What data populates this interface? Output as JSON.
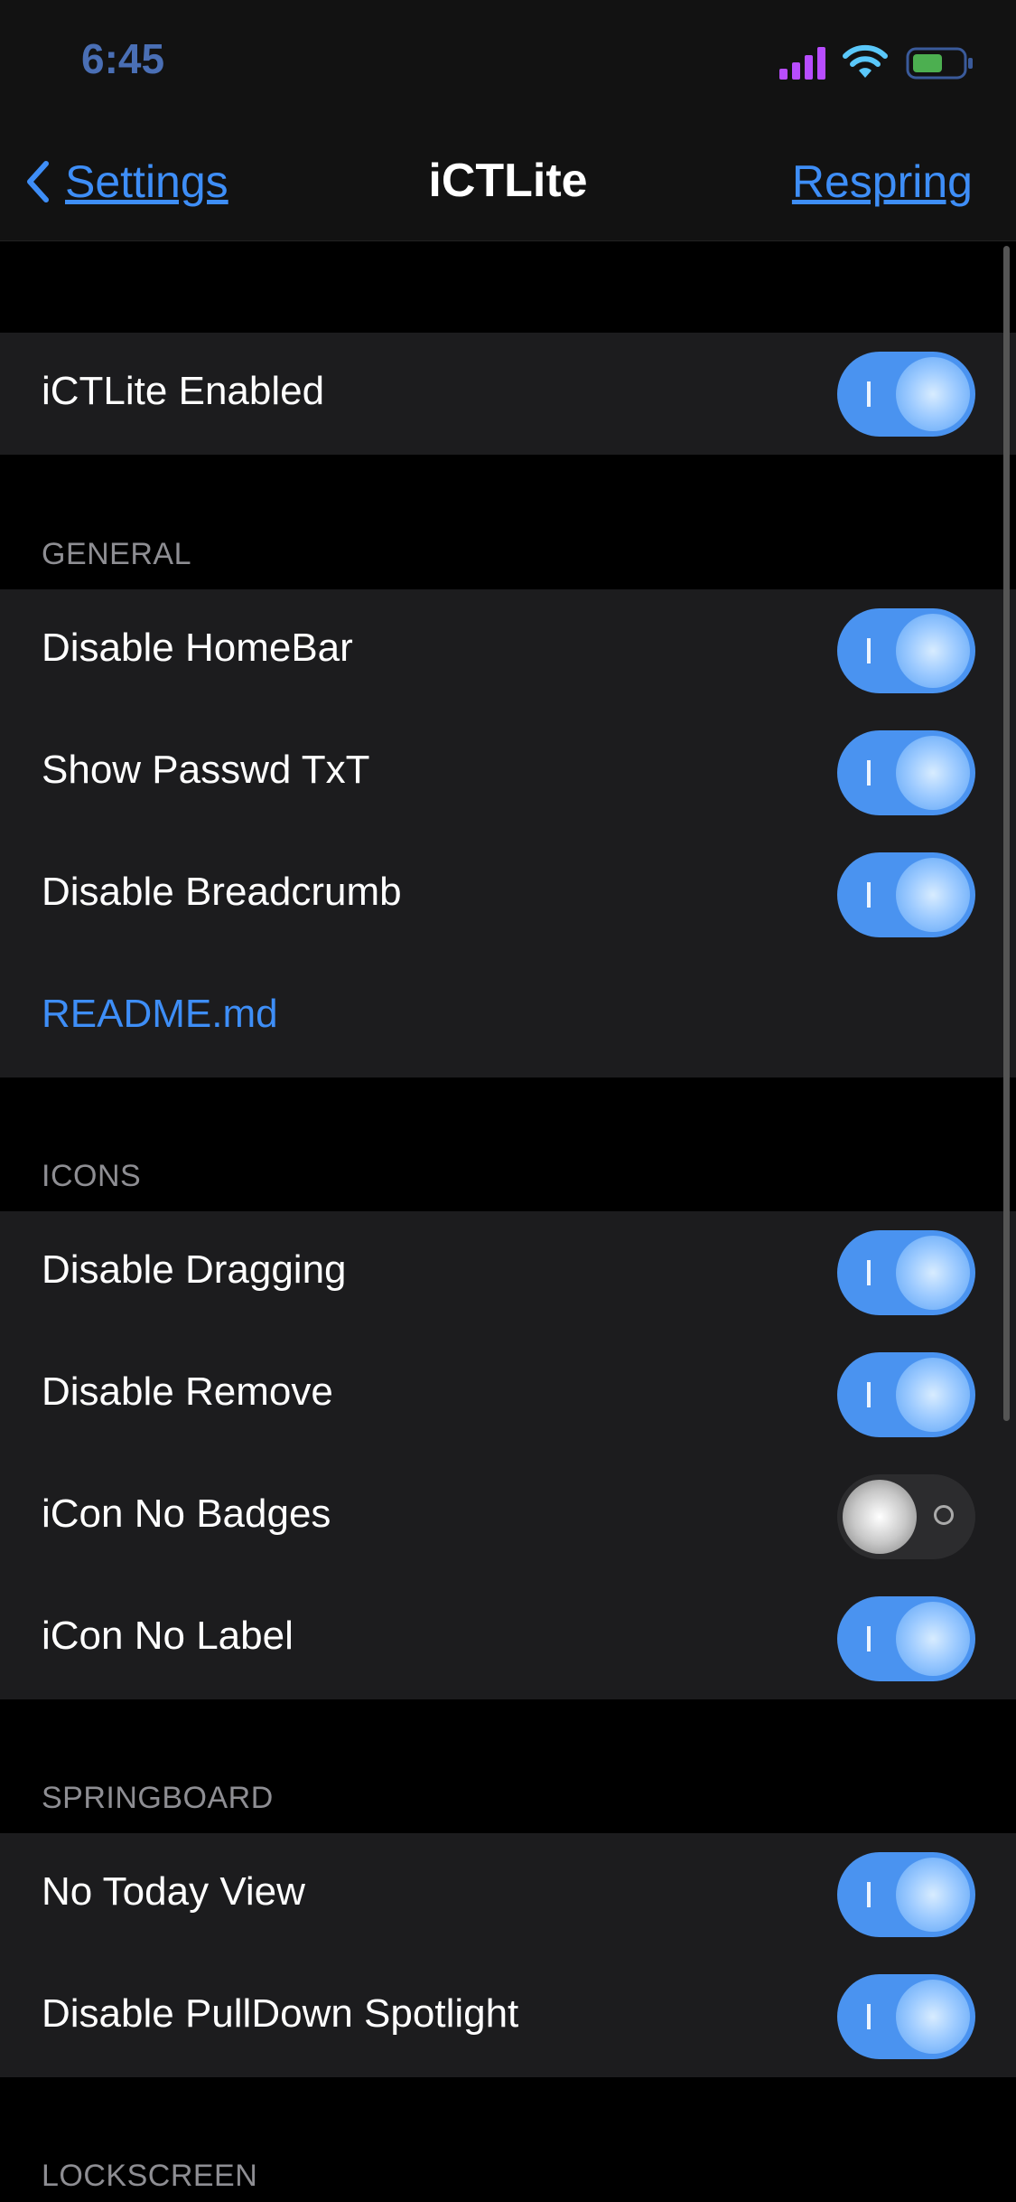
{
  "status_bar": {
    "time": "6:45",
    "signal_color": "#b84dff",
    "wifi_color": "#5ac8fa",
    "battery_color": "#4caf50"
  },
  "nav": {
    "back_label": "Settings",
    "title": "iCTLite",
    "action_label": "Respring"
  },
  "main_toggle": {
    "label": "iCTLite Enabled",
    "on": true
  },
  "sections": {
    "general": {
      "header": "GENERAL",
      "items": [
        {
          "label": "Disable HomeBar",
          "on": true
        },
        {
          "label": "Show Passwd TxT",
          "on": true
        },
        {
          "label": "Disable Breadcrumb",
          "on": true
        }
      ],
      "link_label": "README.md"
    },
    "icons": {
      "header": "ICONS",
      "items": [
        {
          "label": "Disable Dragging",
          "on": true
        },
        {
          "label": "Disable Remove",
          "on": true
        },
        {
          "label": "iCon No Badges",
          "on": false
        },
        {
          "label": "iCon No Label",
          "on": true
        }
      ]
    },
    "springboard": {
      "header": "SPRINGBOARD",
      "items": [
        {
          "label": "No Today View",
          "on": true
        },
        {
          "label": "Disable PullDown Spotlight",
          "on": true
        }
      ]
    },
    "lockscreen": {
      "header": "LOCKSCREEN"
    }
  },
  "colors": {
    "accent": "#3e8ef7",
    "toggle_on": "#4a93f0",
    "cell_bg": "#1c1c1e",
    "header_text": "#8e8e93"
  }
}
